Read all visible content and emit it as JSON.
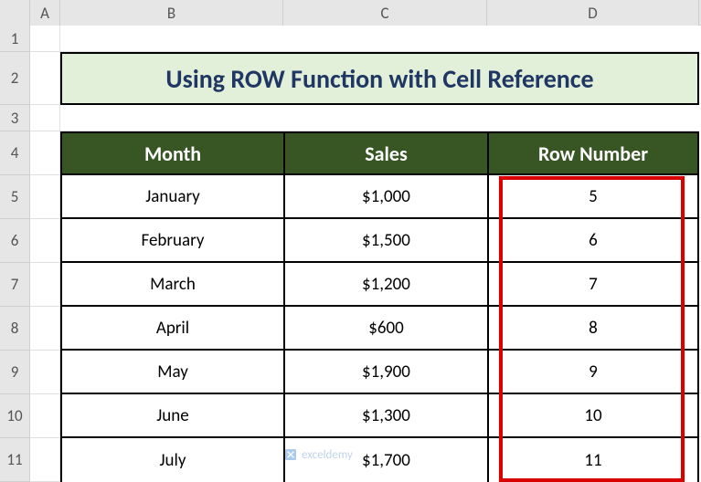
{
  "columns": {
    "A": "A",
    "B": "B",
    "C": "C",
    "D": "D"
  },
  "row_labels": [
    "1",
    "2",
    "3",
    "4",
    "5",
    "6",
    "7",
    "8",
    "9",
    "10",
    "11"
  ],
  "title": "Using ROW Function with Cell Reference",
  "headers": {
    "month": "Month",
    "sales": "Sales",
    "rownum": "Row Number"
  },
  "rows": [
    {
      "month": "January",
      "sales": "$1,000",
      "rownum": "5"
    },
    {
      "month": "February",
      "sales": "$1,500",
      "rownum": "6"
    },
    {
      "month": "March",
      "sales": "$1,200",
      "rownum": "7"
    },
    {
      "month": "April",
      "sales": "$600",
      "rownum": "8"
    },
    {
      "month": "May",
      "sales": "$1,900",
      "rownum": "9"
    },
    {
      "month": "June",
      "sales": "$1,300",
      "rownum": "10"
    },
    {
      "month": "July",
      "sales": "$1,700",
      "rownum": "11"
    }
  ],
  "watermark": "exceldemy",
  "chart_data": {
    "type": "table",
    "title": "Using ROW Function with Cell Reference",
    "columns": [
      "Month",
      "Sales",
      "Row Number"
    ],
    "data": [
      [
        "January",
        1000,
        5
      ],
      [
        "February",
        1500,
        6
      ],
      [
        "March",
        1200,
        7
      ],
      [
        "April",
        600,
        8
      ],
      [
        "May",
        1900,
        9
      ],
      [
        "June",
        1300,
        10
      ],
      [
        "July",
        1700,
        11
      ]
    ]
  }
}
